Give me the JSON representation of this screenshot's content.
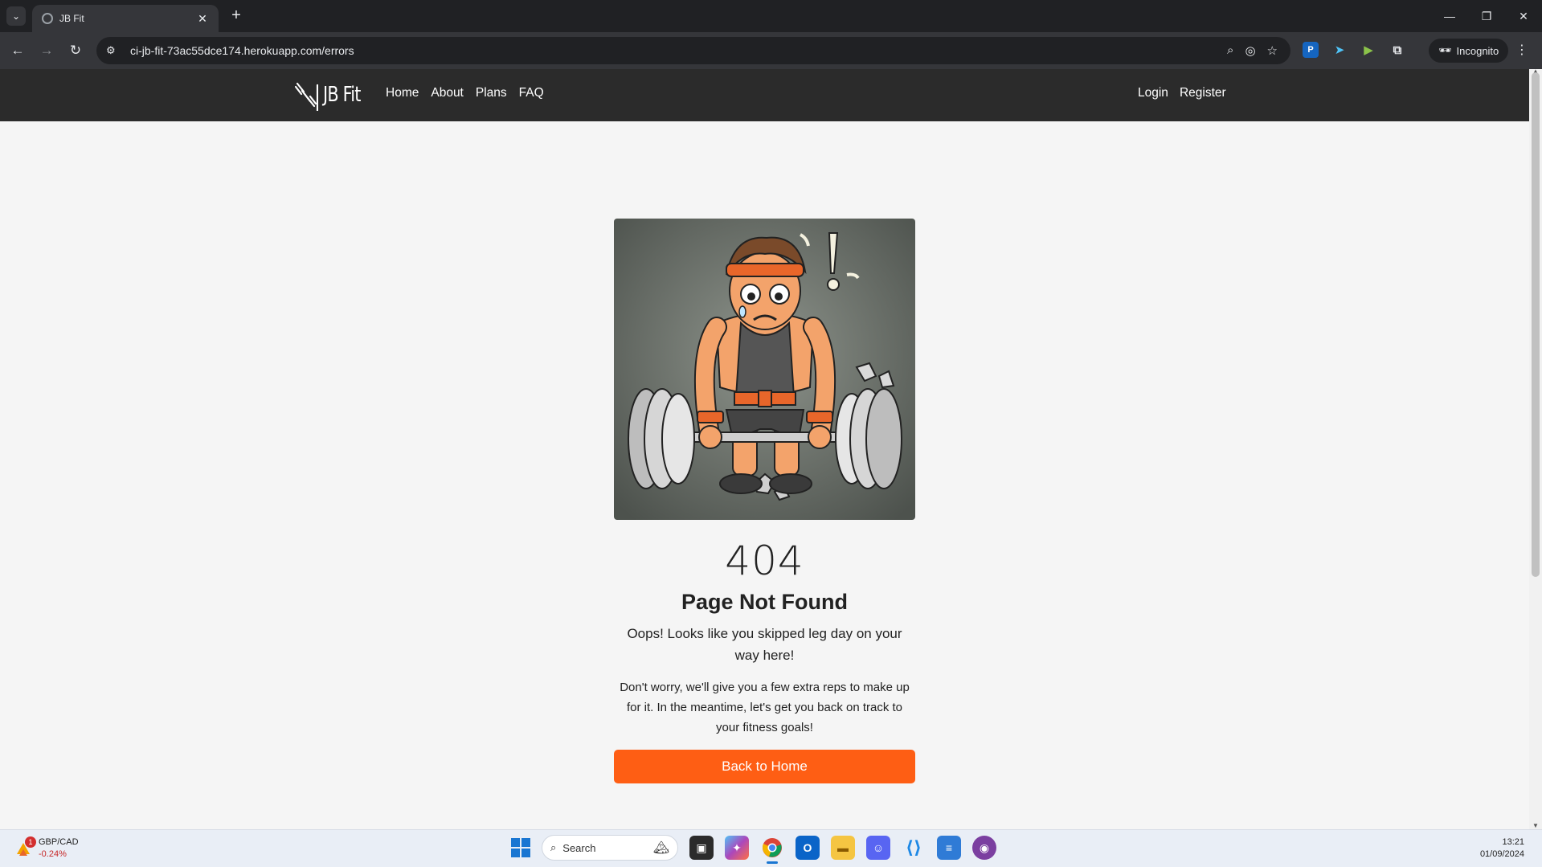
{
  "browser": {
    "tab_title": "JB Fit",
    "url": "ci-jb-fit-73ac55dce174.herokuapp.com/errors",
    "incognito_label": "Incognito"
  },
  "site": {
    "logo_text": "JB Fit",
    "nav": [
      "Home",
      "About",
      "Plans",
      "FAQ"
    ],
    "nav_right": [
      "Login",
      "Register"
    ]
  },
  "error_page": {
    "code": "404",
    "title": "Page Not Found",
    "lead": "Oops! Looks like you skipped leg day on your way here!",
    "body": "Don't worry, we'll give you a few extra reps to make up for it. In the meantime, let's get you back on track to your fitness goals!",
    "button": "Back to Home"
  },
  "taskbar": {
    "widget_badge": "1",
    "widget_pair": "GBP/CAD",
    "widget_change": "-0.24%",
    "search_placeholder": "Search",
    "time": "13:21",
    "date": "01/09/2024"
  },
  "colors": {
    "nav_bg": "#2b2b2b",
    "accent": "#fe5e14",
    "page_bg": "#f5f5f5"
  }
}
